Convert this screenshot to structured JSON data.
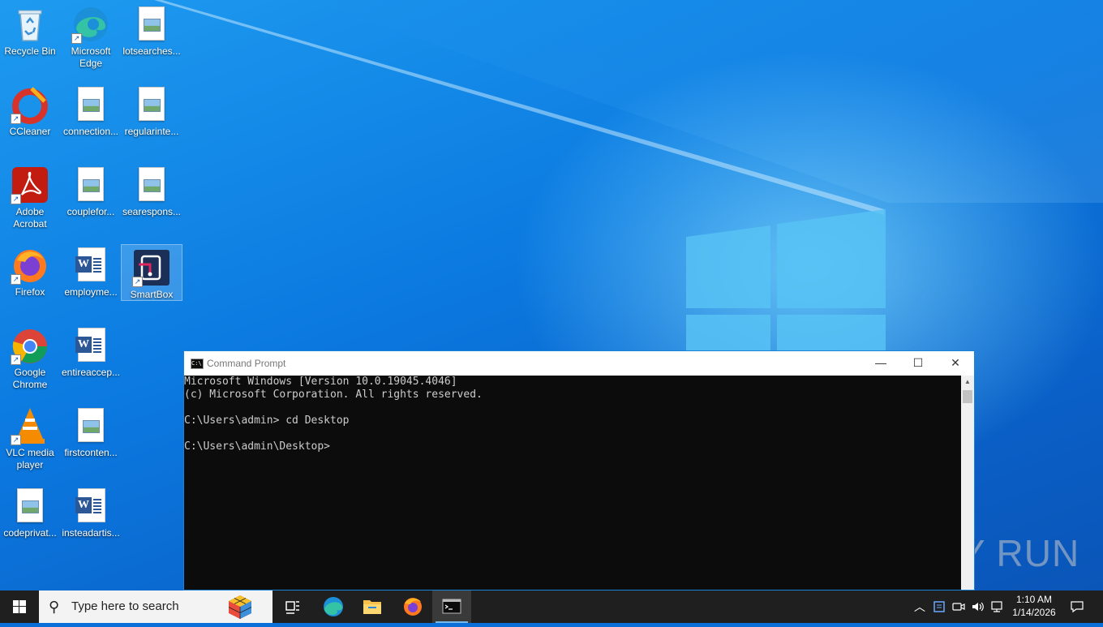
{
  "desktop": {
    "icons": [
      {
        "label": "Recycle Bin",
        "icon": "recycle-bin-icon"
      },
      {
        "label": "Microsoft Edge",
        "icon": "edge-icon"
      },
      {
        "label": "lotsearches...",
        "icon": "image-file-icon"
      },
      {
        "label": "CCleaner",
        "icon": "ccleaner-icon"
      },
      {
        "label": "connection...",
        "icon": "image-file-icon"
      },
      {
        "label": "regularinte...",
        "icon": "image-file-icon"
      },
      {
        "label": "Adobe Acrobat",
        "icon": "acrobat-icon"
      },
      {
        "label": "couplefor...",
        "icon": "image-file-icon"
      },
      {
        "label": "searespons...",
        "icon": "image-file-icon"
      },
      {
        "label": "Firefox",
        "icon": "firefox-icon"
      },
      {
        "label": "employme...",
        "icon": "word-file-icon"
      },
      {
        "label": "SmartBox",
        "icon": "smartbox-icon"
      },
      {
        "label": "Google Chrome",
        "icon": "chrome-icon"
      },
      {
        "label": "entireaccep...",
        "icon": "word-file-icon"
      },
      {
        "label": "VLC media player",
        "icon": "vlc-icon"
      },
      {
        "label": "firstconten...",
        "icon": "image-file-icon"
      },
      {
        "label": "codeprivat...",
        "icon": "image-file-icon"
      },
      {
        "label": "insteadartis...",
        "icon": "word-file-icon"
      }
    ]
  },
  "cmd_window": {
    "title": "Command Prompt",
    "lines": [
      "Microsoft Windows [Version 10.0.19045.4046]",
      "(c) Microsoft Corporation. All rights reserved.",
      "",
      "C:\\Users\\admin> cd Desktop",
      "",
      "C:\\Users\\admin\\Desktop>"
    ],
    "minimize": "—",
    "maximize": "☐",
    "close": "✕"
  },
  "watermark": "ANY RUN",
  "taskbar": {
    "search_placeholder": "Type here to search",
    "time": "1:10 AM",
    "date": "1/14/2026"
  }
}
